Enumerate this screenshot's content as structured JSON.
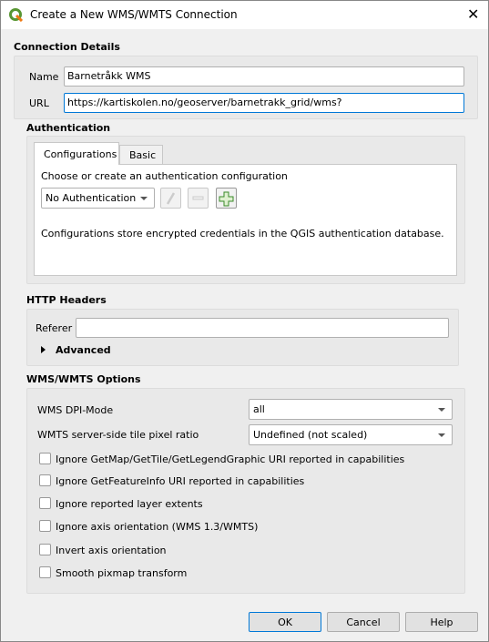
{
  "window": {
    "title": "Create a New WMS/WMTS Connection"
  },
  "connection": {
    "heading": "Connection Details",
    "name_label": "Name",
    "name_value": "Barnetråkk WMS",
    "url_label": "URL",
    "url_value": "https://kartiskolen.no/geoserver/barnetrakk_grid/wms?"
  },
  "auth": {
    "heading": "Authentication",
    "tabs": [
      "Configurations",
      "Basic"
    ],
    "choose_label": "Choose or create an authentication configuration",
    "combo_value": "No Authentication",
    "info": "Configurations store encrypted credentials in the QGIS authentication database."
  },
  "http": {
    "heading": "HTTP Headers",
    "referer_label": "Referer",
    "referer_value": "",
    "advanced_label": "Advanced"
  },
  "options": {
    "heading": "WMS/WMTS Options",
    "dpi_label": "WMS DPI-Mode",
    "dpi_value": "all",
    "tile_label": "WMTS server-side tile pixel ratio",
    "tile_value": "Undefined (not scaled)",
    "checkboxes": [
      {
        "label": "Ignore GetMap/GetTile/GetLegendGraphic URI reported in capabilities",
        "checked": false
      },
      {
        "label": "Ignore GetFeatureInfo URI reported in capabilities",
        "checked": false
      },
      {
        "label": "Ignore reported layer extents",
        "checked": false
      },
      {
        "label": "Ignore axis orientation (WMS 1.3/WMTS)",
        "checked": false
      },
      {
        "label": "Invert axis orientation",
        "checked": false
      },
      {
        "label": "Smooth pixmap transform",
        "checked": false
      }
    ]
  },
  "buttons": {
    "ok": "OK",
    "cancel": "Cancel",
    "help": "Help"
  },
  "colors": {
    "focus": "#0078d7",
    "qgis_green": "#589632"
  }
}
